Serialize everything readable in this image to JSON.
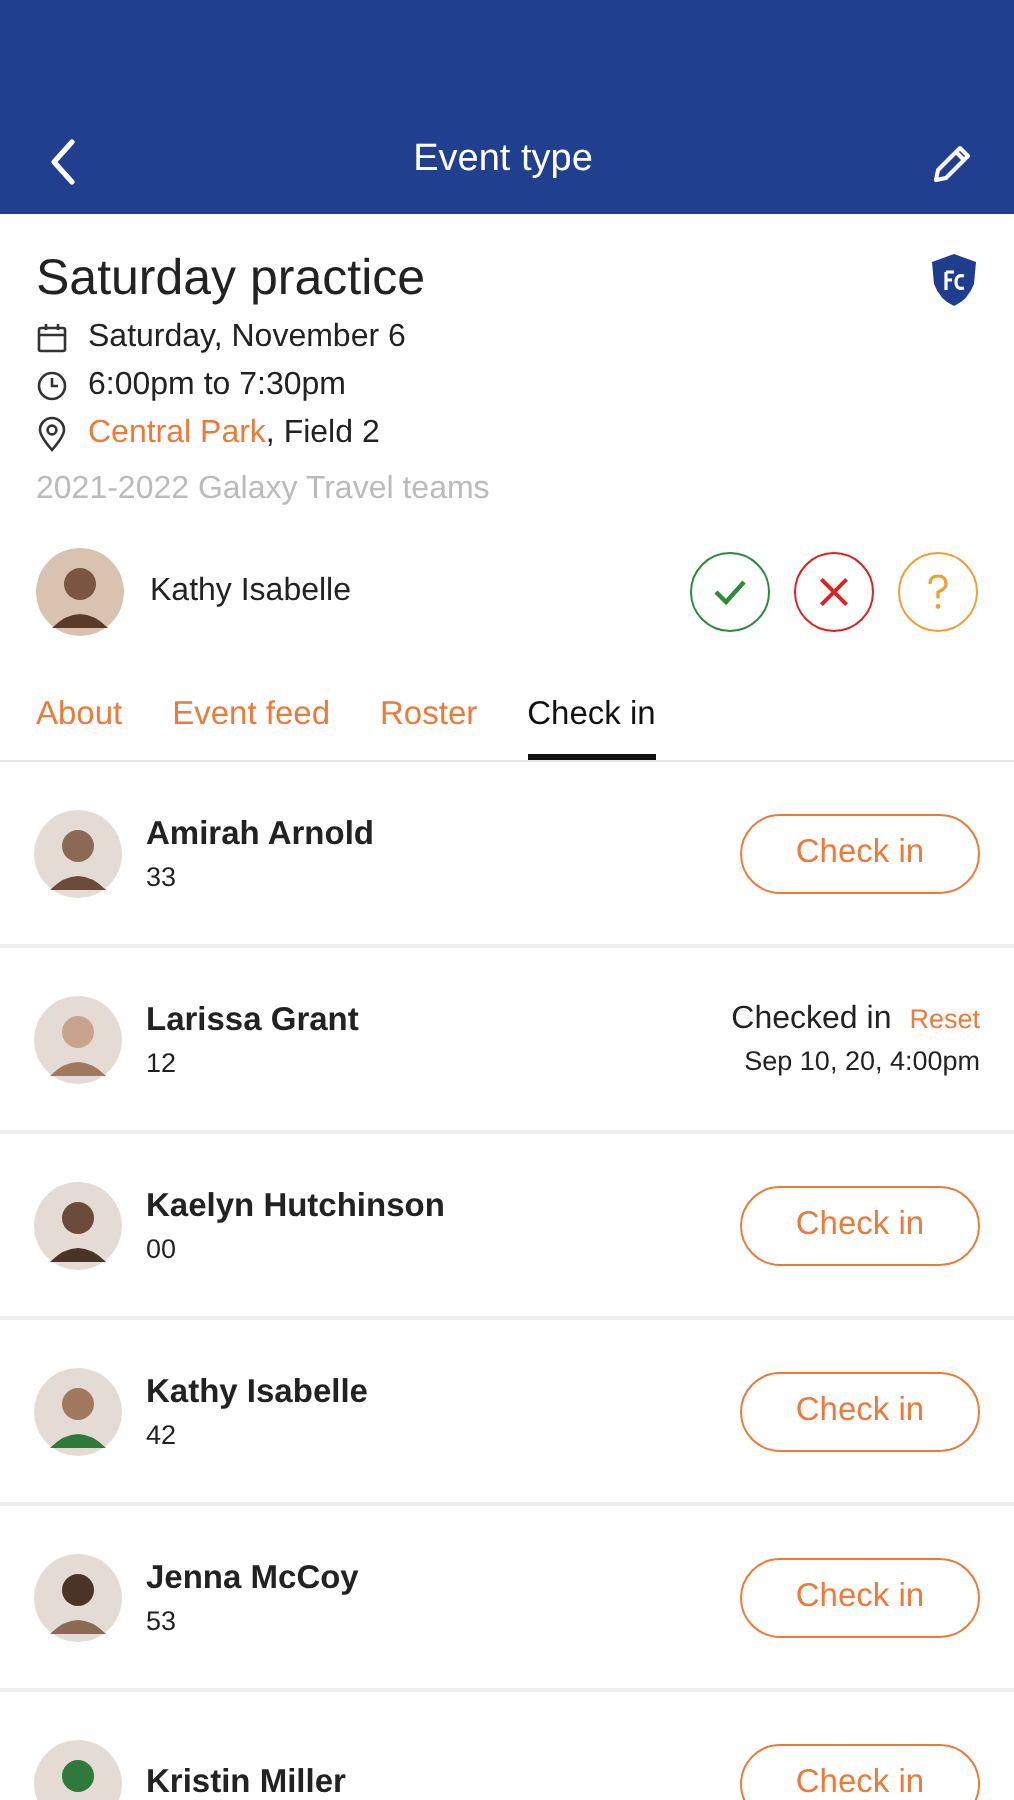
{
  "header": {
    "title": "Event type"
  },
  "event": {
    "title": "Saturday practice",
    "date": "Saturday, November 6",
    "time": "6:00pm to 7:30pm",
    "location_link": "Central Park",
    "location_rest": ", Field 2",
    "group": "2021-2022 Galaxy Travel teams"
  },
  "attendee": {
    "name": "Kathy Isabelle",
    "responses": [
      {
        "kind": "yes"
      },
      {
        "kind": "no"
      },
      {
        "kind": "maybe"
      }
    ]
  },
  "tabs": [
    {
      "label": "About",
      "selected": false
    },
    {
      "label": "Event feed",
      "selected": false
    },
    {
      "label": "Roster",
      "selected": false
    },
    {
      "label": "Check in",
      "selected": true
    }
  ],
  "players": [
    {
      "name": "Amirah Arnold",
      "number": "33",
      "kind": "button",
      "button": "Check in"
    },
    {
      "name": "Larissa Grant",
      "number": "12",
      "kind": "checked",
      "status": "Checked in",
      "reset": "Reset",
      "when": "Sep 10, 20, 4:00pm"
    },
    {
      "name": "Kaelyn Hutchinson",
      "number": "00",
      "kind": "button",
      "button": "Check in"
    },
    {
      "name": "Kathy Isabelle",
      "number": "42",
      "kind": "button",
      "button": "Check in"
    },
    {
      "name": "Jenna McCoy",
      "number": "53",
      "kind": "button",
      "button": "Check in"
    },
    {
      "name": "Kristin Miller",
      "kind": "button",
      "button": "Check in"
    }
  ]
}
